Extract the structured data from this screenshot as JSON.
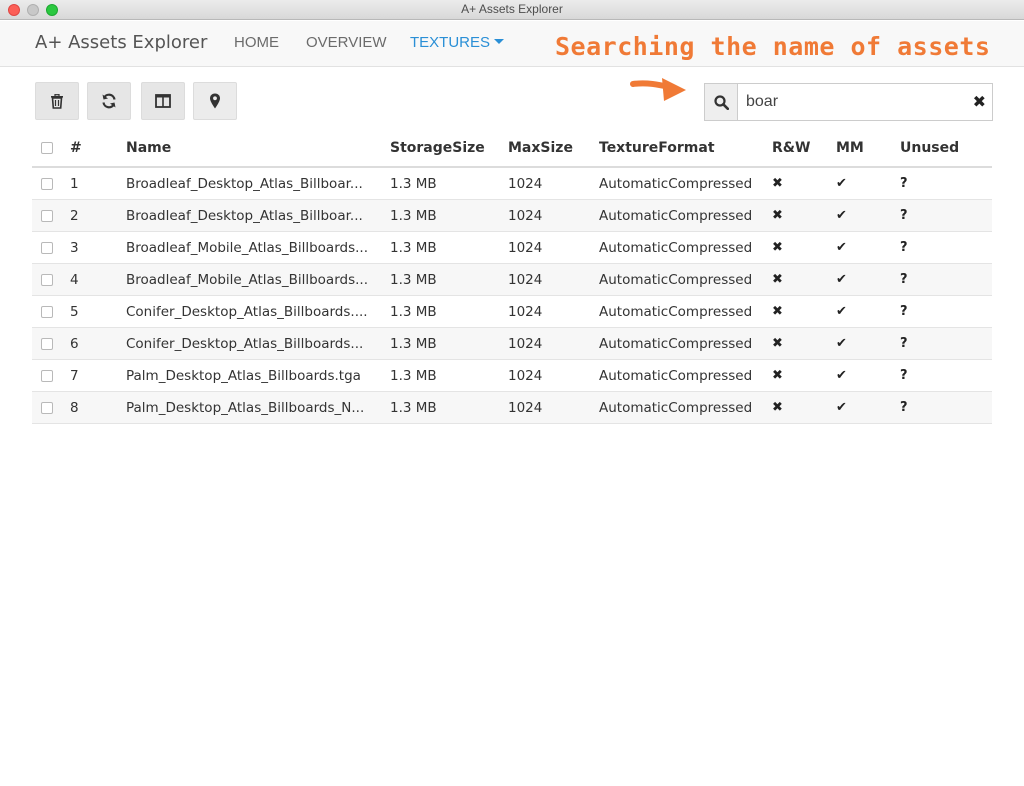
{
  "window": {
    "title": "A+ Assets Explorer"
  },
  "nav": {
    "brand": "A+ Assets Explorer",
    "links": [
      "HOME",
      "OVERVIEW",
      "TEXTURES"
    ],
    "active": "TEXTURES"
  },
  "annotation": "Searching the name of assets",
  "toolbar": {
    "buttons": [
      {
        "icon": "trash-icon"
      },
      {
        "icon": "refresh-icon"
      },
      {
        "icon": "columns-icon"
      },
      {
        "icon": "map-marker-icon"
      }
    ]
  },
  "search": {
    "value": "boar",
    "clear": "✖"
  },
  "table": {
    "headers": {
      "num": "#",
      "name": "Name",
      "storage": "StorageSize",
      "max": "MaxSize",
      "format": "TextureFormat",
      "rw": "R&W",
      "mm": "MM",
      "unused": "Unused"
    },
    "rows": [
      {
        "num": "1",
        "name": "Broadleaf_Desktop_Atlas_Billboar...",
        "storage": "1.3 MB",
        "max": "1024",
        "format": "AutomaticCompressed",
        "rw": "✖",
        "mm": "✔",
        "unused": "?"
      },
      {
        "num": "2",
        "name": "Broadleaf_Desktop_Atlas_Billboar...",
        "storage": "1.3 MB",
        "max": "1024",
        "format": "AutomaticCompressed",
        "rw": "✖",
        "mm": "✔",
        "unused": "?"
      },
      {
        "num": "3",
        "name": "Broadleaf_Mobile_Atlas_Billboards...",
        "storage": "1.3 MB",
        "max": "1024",
        "format": "AutomaticCompressed",
        "rw": "✖",
        "mm": "✔",
        "unused": "?"
      },
      {
        "num": "4",
        "name": "Broadleaf_Mobile_Atlas_Billboards...",
        "storage": "1.3 MB",
        "max": "1024",
        "format": "AutomaticCompressed",
        "rw": "✖",
        "mm": "✔",
        "unused": "?"
      },
      {
        "num": "5",
        "name": "Conifer_Desktop_Atlas_Billboards....",
        "storage": "1.3 MB",
        "max": "1024",
        "format": "AutomaticCompressed",
        "rw": "✖",
        "mm": "✔",
        "unused": "?"
      },
      {
        "num": "6",
        "name": "Conifer_Desktop_Atlas_Billboards...",
        "storage": "1.3 MB",
        "max": "1024",
        "format": "AutomaticCompressed",
        "rw": "✖",
        "mm": "✔",
        "unused": "?"
      },
      {
        "num": "7",
        "name": "Palm_Desktop_Atlas_Billboards.tga",
        "storage": "1.3 MB",
        "max": "1024",
        "format": "AutomaticCompressed",
        "rw": "✖",
        "mm": "✔",
        "unused": "?"
      },
      {
        "num": "8",
        "name": "Palm_Desktop_Atlas_Billboards_N...",
        "storage": "1.3 MB",
        "max": "1024",
        "format": "AutomaticCompressed",
        "rw": "✖",
        "mm": "✔",
        "unused": "?"
      }
    ]
  }
}
